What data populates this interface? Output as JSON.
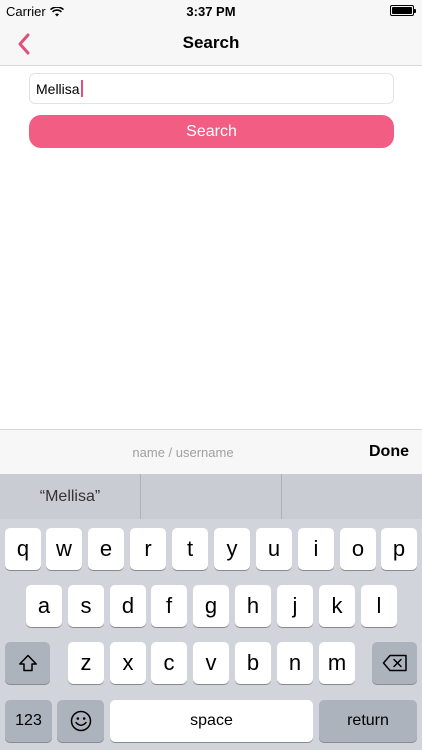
{
  "status_bar": {
    "carrier": "Carrier",
    "time": "3:37 PM",
    "battery_level": 1.0
  },
  "nav": {
    "title": "Search",
    "back_icon": "chevron-left-icon",
    "accent_color": "#e0507a"
  },
  "search": {
    "value": "Mellisa",
    "button_label": "Search",
    "button_color": "#f25d84"
  },
  "accessory": {
    "placeholder": "name / username",
    "done_label": "Done"
  },
  "keyboard": {
    "predictions": [
      "“Mellisa”",
      "",
      ""
    ],
    "row1": [
      "q",
      "w",
      "e",
      "r",
      "t",
      "y",
      "u",
      "i",
      "o",
      "p"
    ],
    "row2": [
      "a",
      "s",
      "d",
      "f",
      "g",
      "h",
      "j",
      "k",
      "l"
    ],
    "row3": [
      "z",
      "x",
      "c",
      "v",
      "b",
      "n",
      "m"
    ],
    "numbers_label": "123",
    "space_label": "space",
    "return_label": "return",
    "shift_icon": "shift-icon",
    "emoji_icon": "emoji-icon",
    "delete_icon": "delete-icon"
  }
}
